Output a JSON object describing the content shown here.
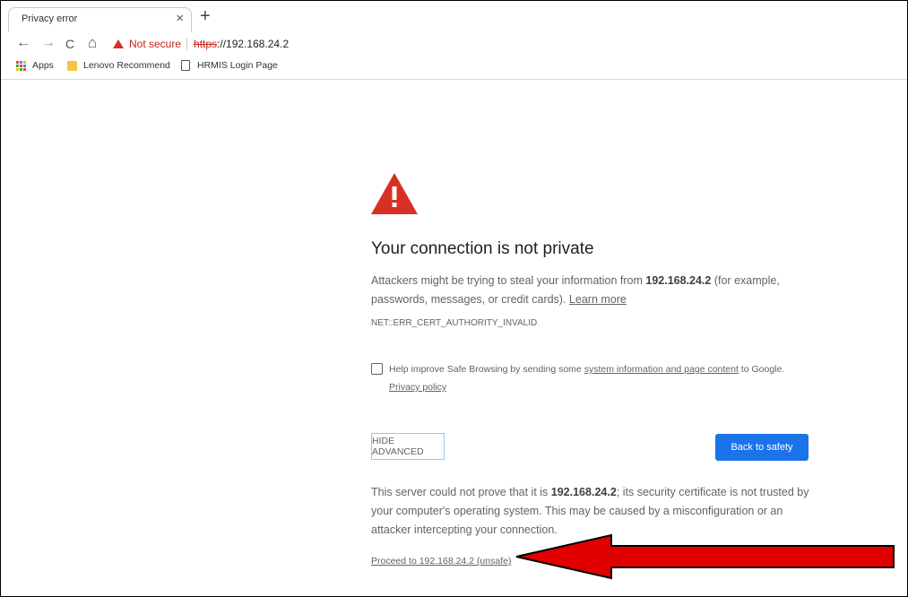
{
  "tab": {
    "title": "Privacy error",
    "close": "×",
    "new_tab": "+"
  },
  "toolbar": {
    "back": "←",
    "forward": "→",
    "reload": "C",
    "home": "⌂",
    "not_secure": "Not secure",
    "https": "https",
    "url_rest": "://192.168.24.2"
  },
  "bookmarks": [
    {
      "label": "Apps",
      "icon": "apps-grid-icon"
    },
    {
      "label": "Lenovo Recommend",
      "icon": "folder-icon"
    },
    {
      "label": "HRMIS Login Page",
      "icon": "page-icon"
    }
  ],
  "main": {
    "heading": "Your connection is not private",
    "intro_1": "Attackers might be trying to steal your information from ",
    "host": "192.168.24.2",
    "intro_2": " (for example,",
    "intro_3": "passwords, messages, or credit cards). ",
    "learn_more": "Learn more",
    "error_code": "NET::ERR_CERT_AUTHORITY_INVALID",
    "checkbox_1": "Help improve Safe Browsing by sending some ",
    "checkbox_link": "system information and page content",
    "checkbox_2": " to Google.",
    "privacy_policy": "Privacy policy",
    "hide_advanced": "HIDE ADVANCED",
    "back_to_safety": "Back to safety",
    "adv_1": "This server could not prove that it is ",
    "adv_host": "192.168.24.2",
    "adv_2": "; its security certificate is not trusted by",
    "adv_3": "your computer's operating system. This may be caused by a misconfiguration or an",
    "adv_4": "attacker intercepting your connection.",
    "proceed": "Proceed to 192.168.24.2 (unsafe)"
  },
  "colors": {
    "warning_red": "#d93025",
    "button_blue": "#1a73e8",
    "annotation_arrow": "#e10000"
  }
}
